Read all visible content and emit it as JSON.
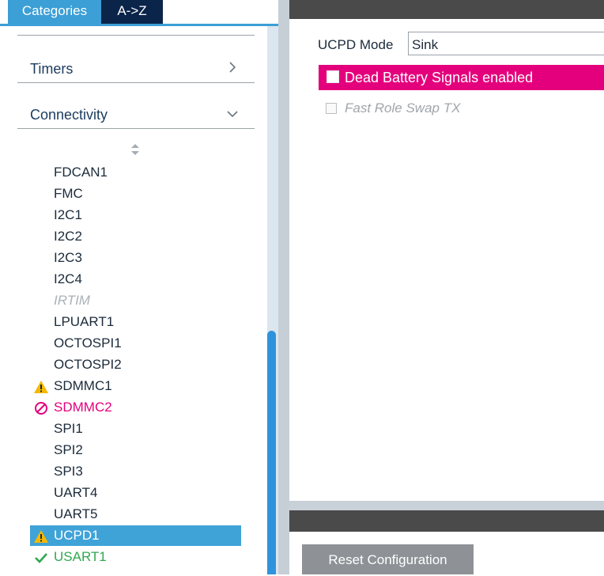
{
  "tabs": {
    "categories": "Categories",
    "a_to_z": "A->Z"
  },
  "categories": {
    "timers": "Timers",
    "connectivity": "Connectivity"
  },
  "peripherals": [
    {
      "label": "FDCAN1",
      "state": "normal"
    },
    {
      "label": "FMC",
      "state": "normal"
    },
    {
      "label": "I2C1",
      "state": "normal"
    },
    {
      "label": "I2C2",
      "state": "normal"
    },
    {
      "label": "I2C3",
      "state": "normal"
    },
    {
      "label": "I2C4",
      "state": "normal"
    },
    {
      "label": "IRTIM",
      "state": "disabled"
    },
    {
      "label": "LPUART1",
      "state": "normal"
    },
    {
      "label": "OCTOSPI1",
      "state": "normal"
    },
    {
      "label": "OCTOSPI2",
      "state": "normal"
    },
    {
      "label": "SDMMC1",
      "state": "warning"
    },
    {
      "label": "SDMMC2",
      "state": "error"
    },
    {
      "label": "SPI1",
      "state": "normal"
    },
    {
      "label": "SPI2",
      "state": "normal"
    },
    {
      "label": "SPI3",
      "state": "normal"
    },
    {
      "label": "UART4",
      "state": "normal"
    },
    {
      "label": "UART5",
      "state": "normal"
    },
    {
      "label": "UCPD1",
      "state": "warning",
      "selected": true
    },
    {
      "label": "USART1",
      "state": "ok"
    }
  ],
  "config": {
    "mode_label": "UCPD Mode",
    "mode_value": "Sink",
    "dead_battery_label": "Dead Battery Signals enabled",
    "dead_battery_checked": false,
    "fast_role_swap_label": "Fast Role Swap TX",
    "fast_role_swap_checked": false,
    "reset_label": "Reset Configuration"
  },
  "colors": {
    "accent_blue": "#3c9fd6",
    "tab_dark": "#0b2449",
    "magenta": "#e4007c",
    "warning_yellow": "#f5b800",
    "ok_green": "#2fa84f"
  },
  "icons": {
    "warning": "warning-icon",
    "error": "prohibited-icon",
    "ok": "checkmark-icon",
    "expand": "chevron-right-icon",
    "collapse": "chevron-down-icon",
    "sort": "sort-icon"
  }
}
